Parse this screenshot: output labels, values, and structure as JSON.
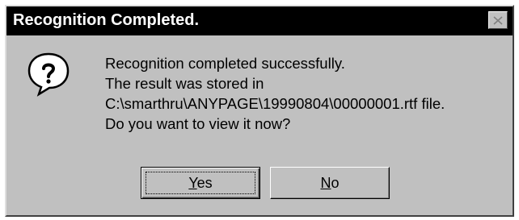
{
  "window": {
    "title": "Recognition Completed."
  },
  "icons": {
    "message_icon": "question-icon",
    "close_icon": "close-icon"
  },
  "message": {
    "lines": [
      "Recognition completed successfully.",
      "The result was stored in",
      "C:\\smarthru\\ANYPAGE\\19990804\\00000001.rtf file.",
      "Do you want to view it now?"
    ]
  },
  "buttons": {
    "yes": {
      "mnemonic": "Y",
      "rest": "es"
    },
    "no": {
      "mnemonic": "N",
      "rest": "o"
    }
  },
  "colors": {
    "dialog_face": "#c0c0c0",
    "titlebar": "#000000",
    "title_text": "#ffffff"
  }
}
